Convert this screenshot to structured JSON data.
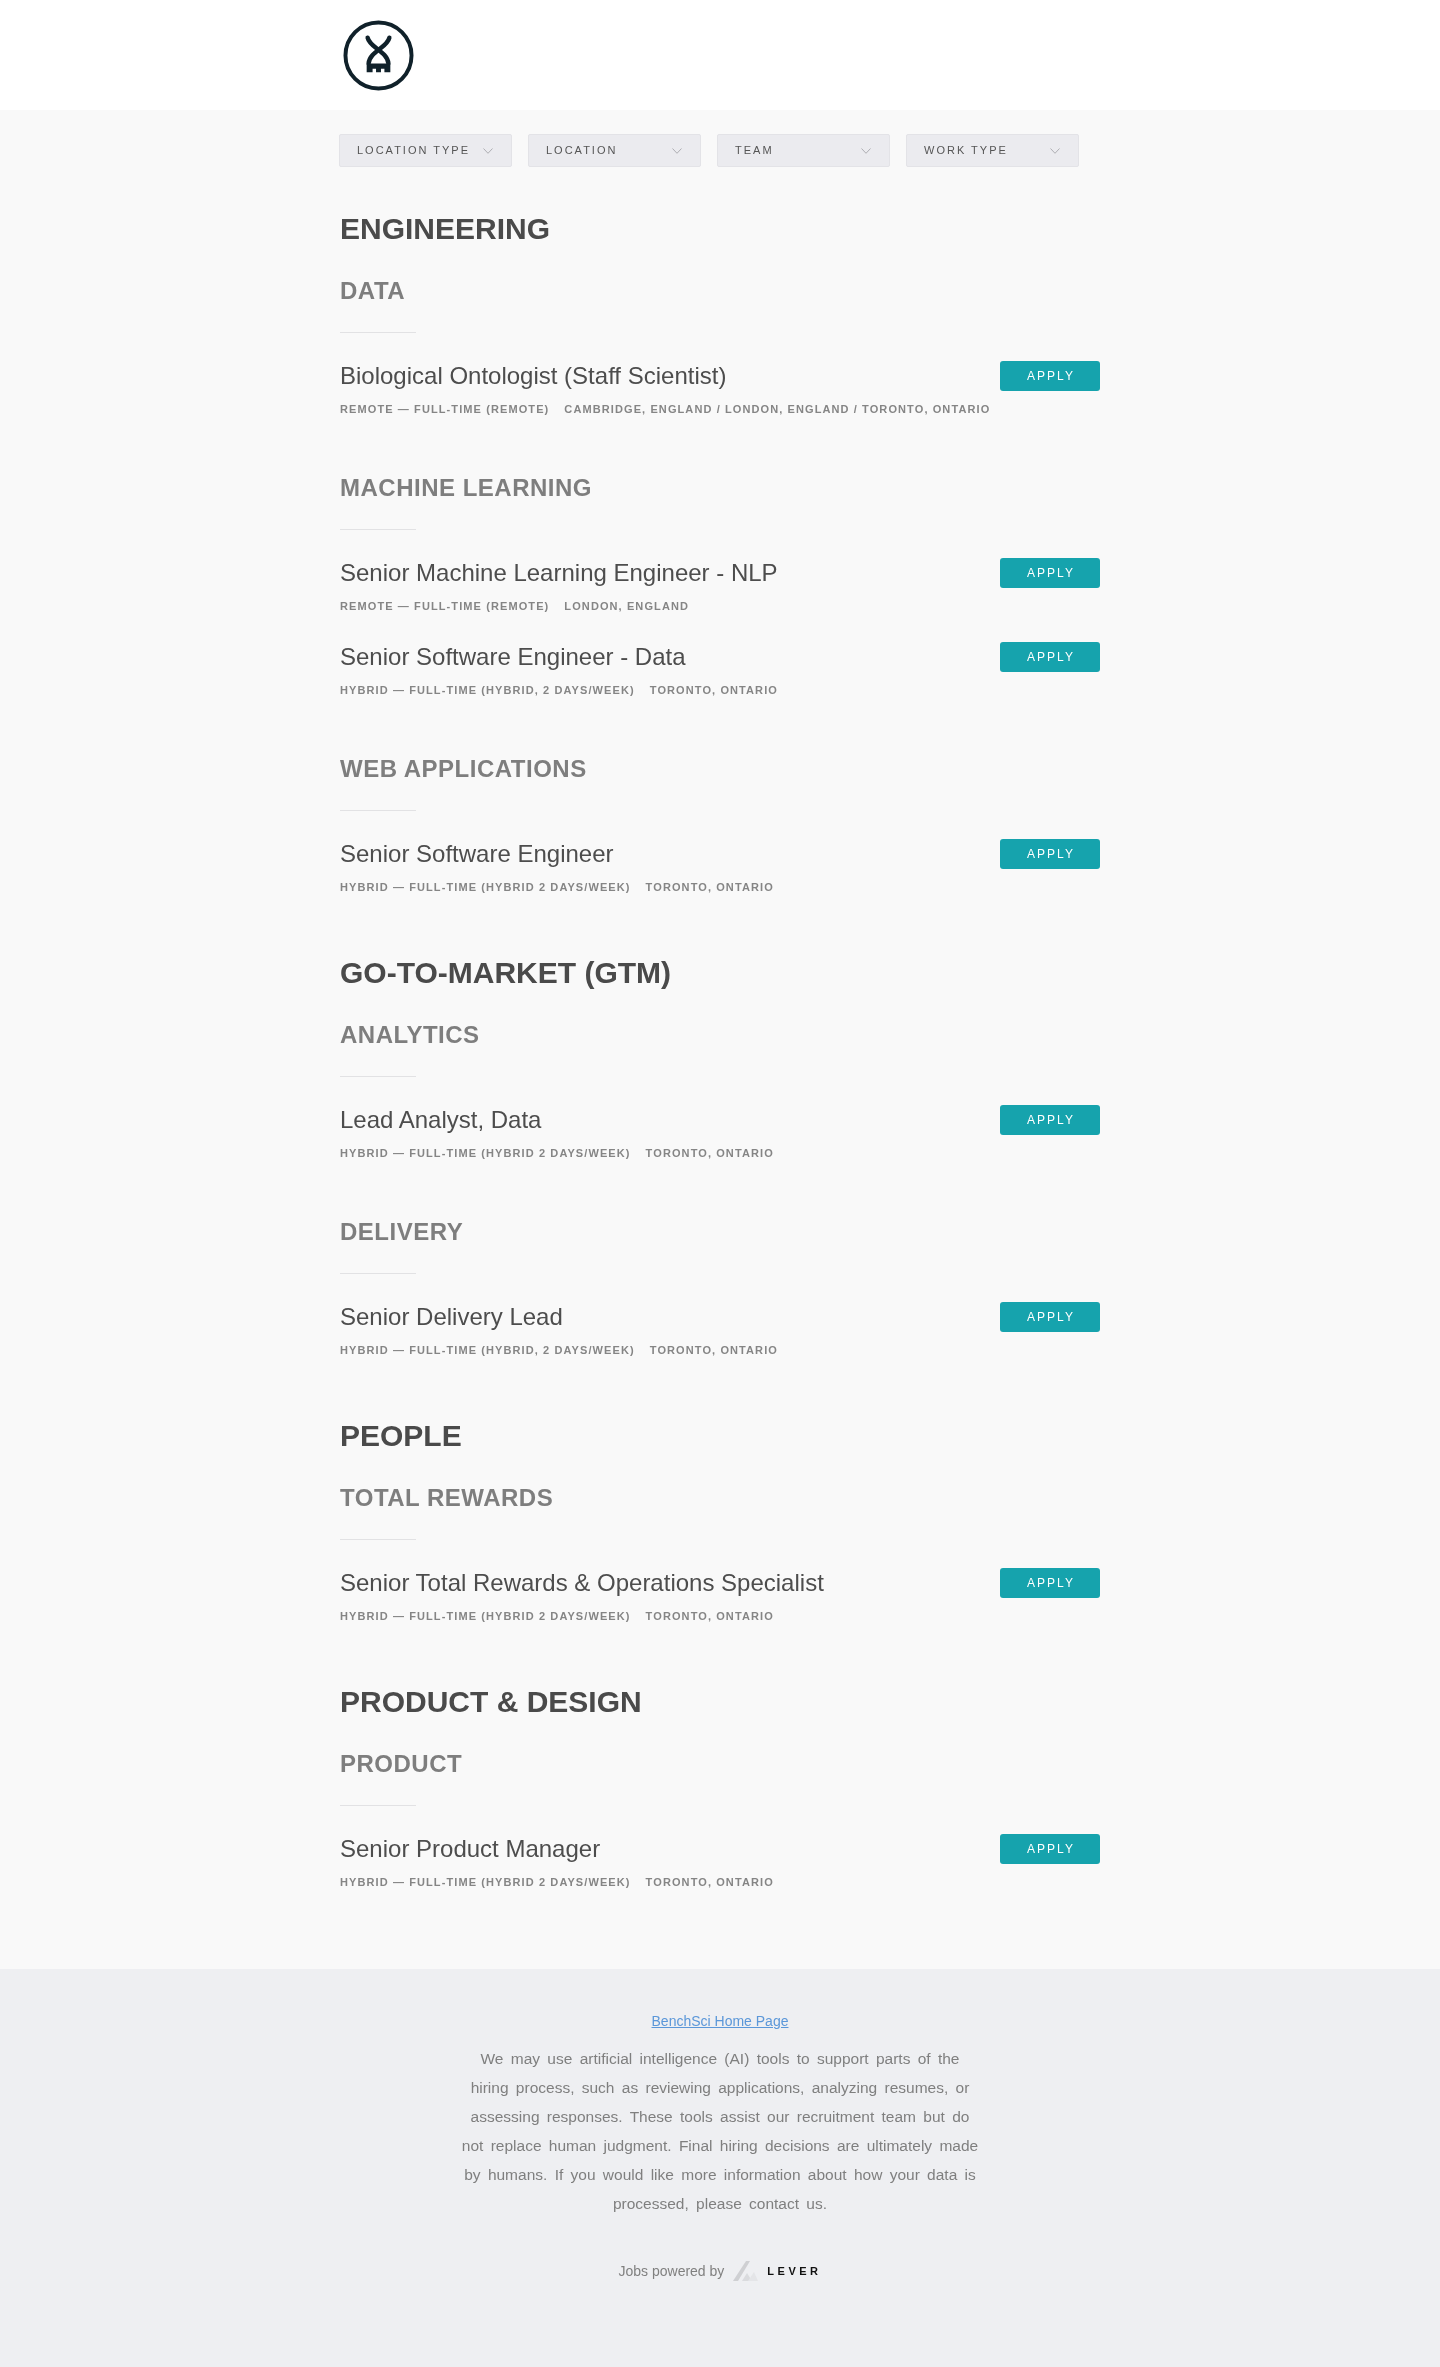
{
  "filters": [
    "LOCATION TYPE",
    "LOCATION",
    "TEAM",
    "WORK TYPE"
  ],
  "categories": [
    {
      "title": "ENGINEERING",
      "teams": [
        {
          "title": "DATA",
          "postings": [
            {
              "title": "Biological Ontologist (Staff Scientist)",
              "commitment": "REMOTE — FULL-TIME (REMOTE)",
              "location": "CAMBRIDGE, ENGLAND / LONDON, ENGLAND / TORONTO, ONTARIO",
              "button": "APPLY"
            }
          ]
        },
        {
          "title": "MACHINE LEARNING",
          "postings": [
            {
              "title": "Senior Machine Learning Engineer - NLP",
              "commitment": "REMOTE — FULL-TIME (REMOTE)",
              "location": "LONDON, ENGLAND",
              "button": "APPLY"
            },
            {
              "title": "Senior Software Engineer - Data",
              "commitment": "HYBRID — FULL-TIME (HYBRID, 2 DAYS/WEEK)",
              "location": "TORONTO, ONTARIO",
              "button": "APPLY"
            }
          ]
        },
        {
          "title": "WEB APPLICATIONS",
          "postings": [
            {
              "title": "Senior Software Engineer",
              "commitment": "HYBRID — FULL-TIME (HYBRID 2 DAYS/WEEK)",
              "location": "TORONTO, ONTARIO",
              "button": "APPLY"
            }
          ]
        }
      ]
    },
    {
      "title": "GO-TO-MARKET (GTM)",
      "teams": [
        {
          "title": "ANALYTICS",
          "postings": [
            {
              "title": "Lead Analyst, Data",
              "commitment": "HYBRID — FULL-TIME (HYBRID 2 DAYS/WEEK)",
              "location": "TORONTO, ONTARIO",
              "button": "APPLY"
            }
          ]
        },
        {
          "title": "DELIVERY",
          "postings": [
            {
              "title": "Senior Delivery Lead",
              "commitment": "HYBRID — FULL-TIME (HYBRID, 2 DAYS/WEEK)",
              "location": "TORONTO, ONTARIO",
              "button": "APPLY"
            }
          ]
        }
      ]
    },
    {
      "title": "PEOPLE",
      "teams": [
        {
          "title": "TOTAL REWARDS",
          "postings": [
            {
              "title": "Senior Total Rewards & Operations Specialist",
              "commitment": "HYBRID — FULL-TIME (HYBRID 2 DAYS/WEEK)",
              "location": "TORONTO, ONTARIO",
              "button": "APPLY"
            }
          ]
        }
      ]
    },
    {
      "title": "PRODUCT & DESIGN",
      "teams": [
        {
          "title": "PRODUCT",
          "postings": [
            {
              "title": "Senior Product Manager",
              "commitment": "HYBRID — FULL-TIME (HYBRID 2 DAYS/WEEK)",
              "location": "TORONTO, ONTARIO",
              "button": "APPLY"
            }
          ]
        }
      ]
    }
  ],
  "footer": {
    "link": "BenchSci Home Page",
    "notice": "We may use artificial intelligence (AI) tools to support parts of the hiring process, such as reviewing applications, analyzing resumes, or assessing responses. These tools assist our recruitment team but do not replace human judgment. Final hiring decisions are ultimately made by humans. If you would like more information about how your data is processed, please contact us.",
    "powered_by": "Jobs powered by",
    "brand": "LEVER"
  }
}
